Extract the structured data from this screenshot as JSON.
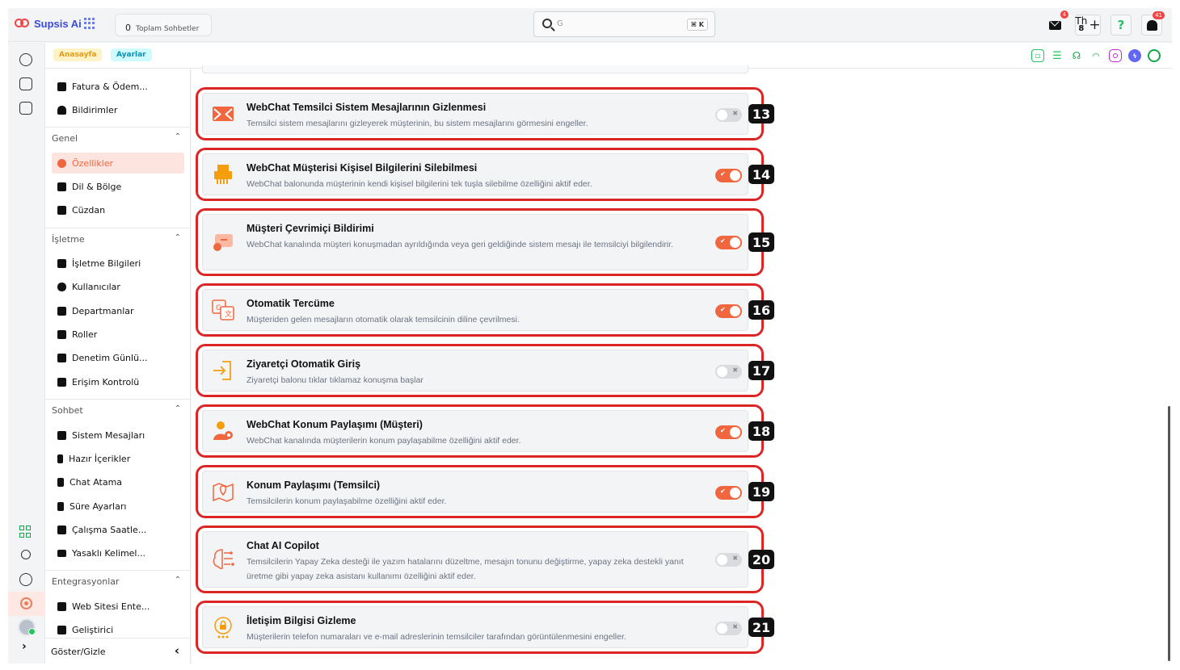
{
  "app": {
    "name": "Supsis Ai"
  },
  "topbar": {
    "total_chats_count": "0",
    "total_chats_label": "Toplam Sohbetler",
    "search_value": "G",
    "search_shortcut": "⌘ K",
    "mail_badge": "4",
    "th_label": "Th",
    "th_count": "8",
    "plus_label": "+",
    "help_label": "?",
    "bell_badge": "41"
  },
  "breadcrumbs": [
    {
      "label": "Anasayfa"
    },
    {
      "label": "Ayarlar"
    }
  ],
  "channel_icons": [
    "webchat-icon",
    "list-icon",
    "voice-icon",
    "wifi-icon",
    "instagram-icon",
    "messenger-icon",
    "whatsapp-icon"
  ],
  "menu": {
    "top_items": [
      {
        "label": "Fatura & Ödem...",
        "icon": "invoice-icon"
      },
      {
        "label": "Bildirimler",
        "icon": "bell-icon"
      }
    ],
    "sections": [
      {
        "title": "Genel",
        "items": [
          {
            "label": "Özellikler",
            "icon": "gear-icon",
            "active": true
          },
          {
            "label": "Dil & Bölge",
            "icon": "translate-icon"
          },
          {
            "label": "Cüzdan",
            "icon": "wallet-icon"
          }
        ]
      },
      {
        "title": "İşletme",
        "items": [
          {
            "label": "İşletme Bilgileri",
            "icon": "building-icon"
          },
          {
            "label": "Kullanıcılar",
            "icon": "users-icon"
          },
          {
            "label": "Departmanlar",
            "icon": "departments-icon"
          },
          {
            "label": "Roller",
            "icon": "roles-icon"
          },
          {
            "label": "Denetim Günlü...",
            "icon": "audit-log-icon"
          },
          {
            "label": "Erişim Kontrolü",
            "icon": "access-control-icon"
          }
        ]
      },
      {
        "title": "Sohbet",
        "items": [
          {
            "label": "Sistem Mesajları",
            "icon": "system-messages-icon"
          },
          {
            "label": "Hazır İçerikler",
            "icon": "lightning-icon"
          },
          {
            "label": "Chat Atama",
            "icon": "assign-icon"
          },
          {
            "label": "Süre Ayarları",
            "icon": "hourglass-icon"
          },
          {
            "label": "Çalışma Saatle...",
            "icon": "calendar-icon"
          },
          {
            "label": "Yasaklı Kelimel...",
            "icon": "keyboard-icon"
          }
        ]
      },
      {
        "title": "Entegrasyonlar",
        "items": [
          {
            "label": "Web Sitesi Ente...",
            "icon": "website-icon"
          },
          {
            "label": "Geliştirici",
            "icon": "developer-icon"
          }
        ]
      }
    ],
    "footer_label": "Göster/Gizle"
  },
  "features": [
    {
      "number": "13",
      "title": "WebChat Temsilci Sistem Mesajlarının Gizlenmesi",
      "description": "Temsilci sistem mesajlarını gizleyerek müşterinin, bu sistem mesajlarını görmesini engeller.",
      "enabled": false,
      "icon": "hidden-message-icon"
    },
    {
      "number": "14",
      "title": "WebChat Müşterisi Kişisel Bilgilerini Silebilmesi",
      "description": "WebChat balonunda müşterinin kendi kişisel bilgilerini tek tuşla silebilme özelliğini aktif eder.",
      "enabled": true,
      "icon": "shredder-icon"
    },
    {
      "number": "15",
      "title": "Müşteri Çevrimiçi Bildirimi",
      "description": "WebChat kanalında müşteri konuşmadan ayrıldığında veya geri geldiğinde sistem mesajı ile temsilciyi bilgilendirir.",
      "enabled": true,
      "icon": "online-notification-icon"
    },
    {
      "number": "16",
      "title": "Otomatik Tercüme",
      "description": "Müşteriden gelen mesajların otomatik olarak temsilcinin diline çevrilmesi.",
      "enabled": true,
      "icon": "translate-icon"
    },
    {
      "number": "17",
      "title": "Ziyaretçi Otomatik Giriş",
      "description": "Ziyaretçi balonu tıklar tıklamaz konuşma başlar",
      "enabled": false,
      "icon": "login-icon"
    },
    {
      "number": "18",
      "title": "WebChat Konum Paylaşımı (Müşteri)",
      "description": "WebChat kanalında müşterilerin konum paylaşabilme özelliğini aktif eder.",
      "enabled": true,
      "icon": "user-location-icon"
    },
    {
      "number": "19",
      "title": "Konum Paylaşımı (Temsilci)",
      "description": "Temsilcilerin konum paylaşabilme özelliğini aktif eder.",
      "enabled": true,
      "icon": "map-pin-icon"
    },
    {
      "number": "20",
      "title": "Chat AI Copilot",
      "description": "Temsilcilerin Yapay Zeka desteği ile yazım hatalarını düzeltme, mesajın tonunu değiştirme, yapay zeka destekli yanıt üretme gibi yapay zeka asistanı kullanımı özelliğini aktif eder.",
      "enabled": false,
      "icon": "ai-brain-icon"
    },
    {
      "number": "21",
      "title": "İletişim Bilgisi Gizleme",
      "description": "Müşterilerin telefon numaraları ve e-mail adreslerinin temsilciler tarafından görüntülenmesini engeller.",
      "enabled": false,
      "icon": "lock-bubble-icon"
    }
  ],
  "toggle_marks": {
    "on": "✔",
    "off": "✖"
  },
  "colors": {
    "accent": "#f0673f",
    "highlight": "#dc2626",
    "brand": "#3b4bd8"
  }
}
